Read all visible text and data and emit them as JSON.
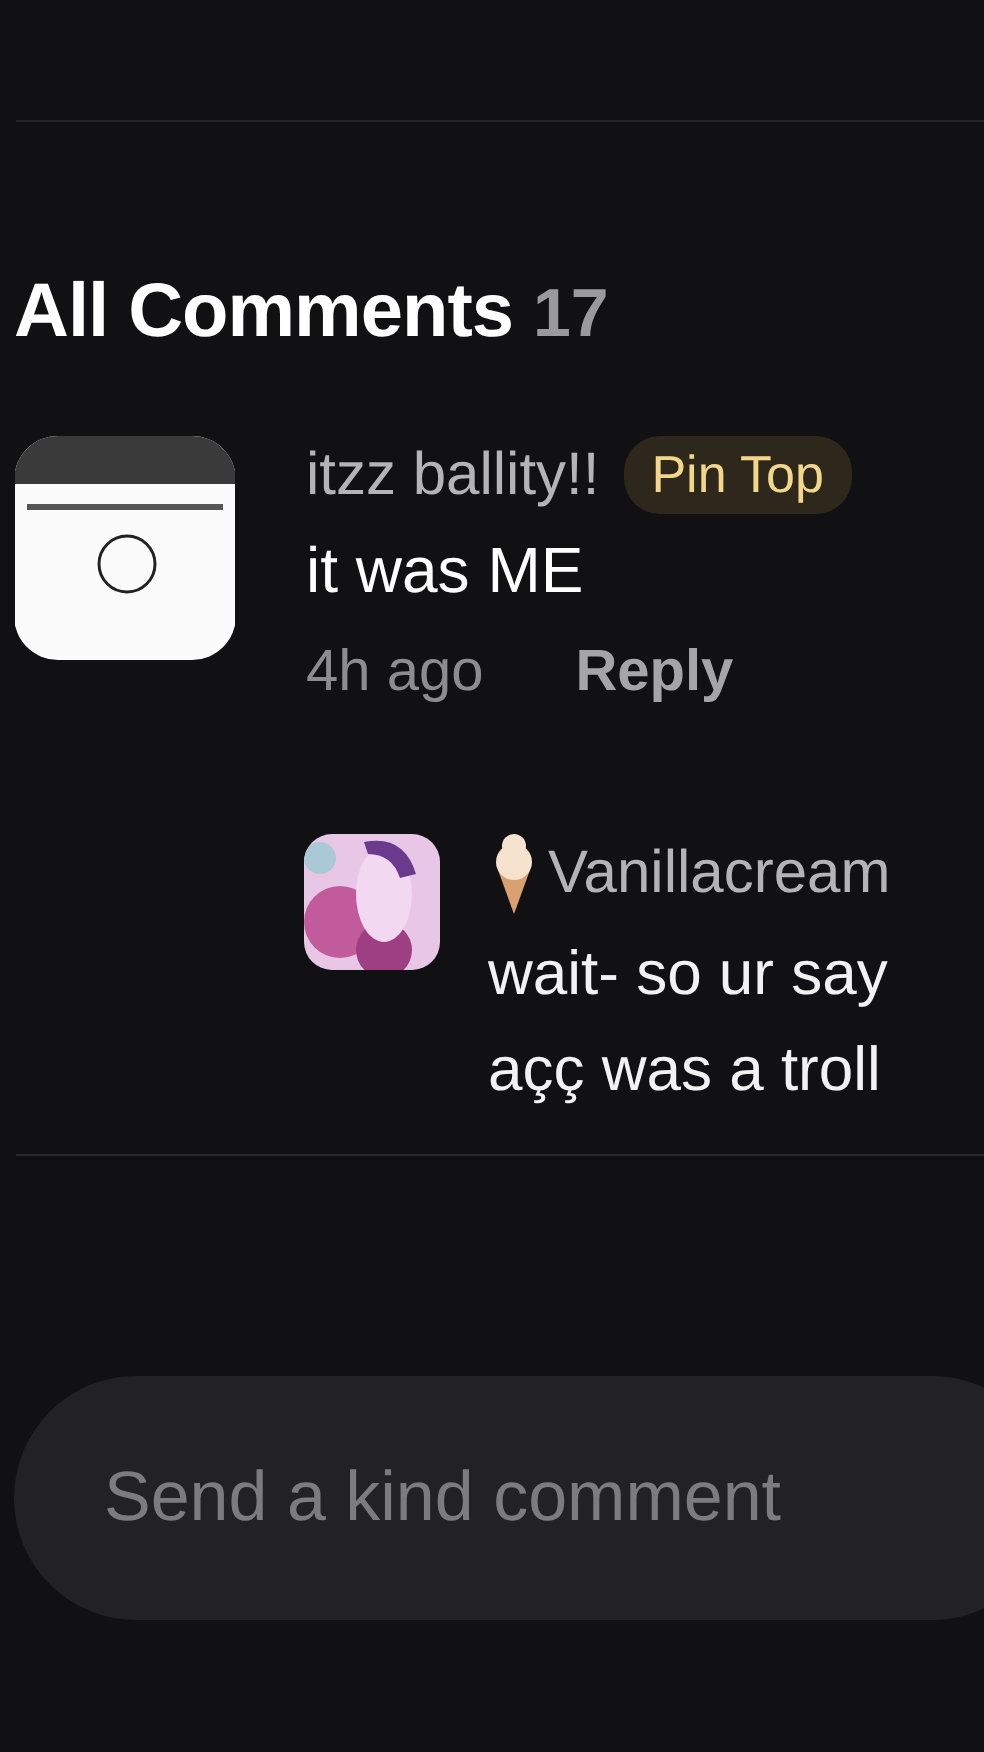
{
  "header": {
    "title": "All Comments",
    "count": "17"
  },
  "comment": {
    "author": "itzz ballity!!",
    "badge": "Pin Top",
    "text": "it was ME",
    "time": "4h ago",
    "reply_action": "Reply"
  },
  "reply": {
    "author": "Vanillacream",
    "lines": [
      "wait- so ur say",
      "açç was a troll"
    ]
  },
  "composer": {
    "placeholder": "Send a kind comment"
  }
}
